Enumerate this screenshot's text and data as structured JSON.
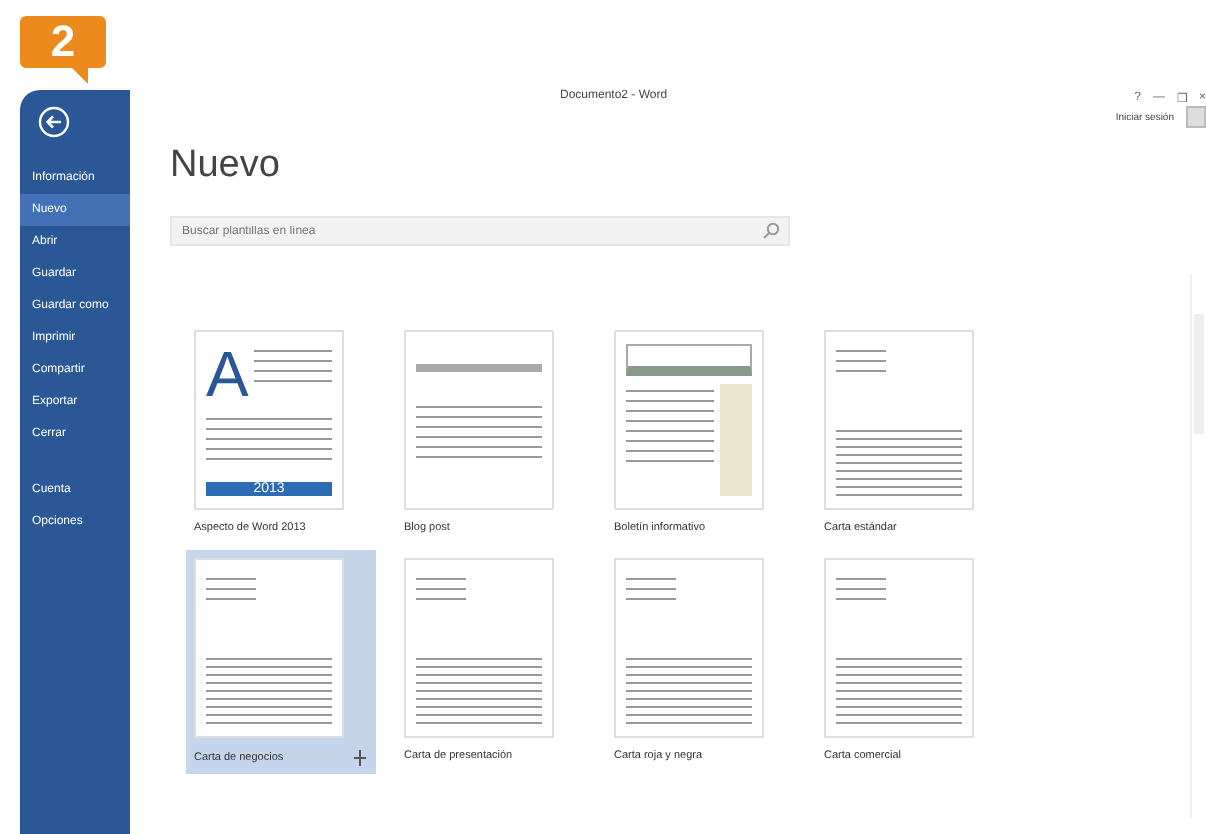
{
  "step_badge": "2",
  "window": {
    "title": "Documento2 - Word",
    "controls": [
      "?",
      "—",
      "❐",
      "×"
    ],
    "account": "Iniciar sesión"
  },
  "sidebar": {
    "items": [
      {
        "label": "Información",
        "selected": false
      },
      {
        "label": "Nuevo",
        "selected": true
      },
      {
        "label": "Abrir",
        "selected": false
      },
      {
        "label": "Guardar",
        "selected": false
      },
      {
        "label": "Guardar como",
        "selected": false
      },
      {
        "label": "Imprimir",
        "selected": false
      },
      {
        "label": "Compartir",
        "selected": false
      },
      {
        "label": "Exportar",
        "selected": false
      },
      {
        "label": "Cerrar",
        "selected": false
      },
      {
        "label": "Cuenta",
        "selected": false
      },
      {
        "label": "Opciones",
        "selected": false
      }
    ]
  },
  "page": {
    "heading": "Nuevo",
    "search": {
      "placeholder": "Buscar plantillas en línea"
    },
    "templates": [
      {
        "name": "Aspecto de Word 2013",
        "kind": "welcome",
        "glyph": "A",
        "badge": "2013",
        "selected": false
      },
      {
        "name": "Blog post",
        "kind": "blog",
        "selected": false
      },
      {
        "name": "Boletín informativo",
        "kind": "newsletter",
        "selected": false
      },
      {
        "name": "Carta estándar",
        "kind": "letter",
        "selected": false
      },
      {
        "name": "Carta de negocios",
        "kind": "letter",
        "selected": true
      },
      {
        "name": "Carta de presentación",
        "kind": "letter",
        "selected": false
      },
      {
        "name": "Carta roja y negra",
        "kind": "letter",
        "selected": false
      },
      {
        "name": "Carta comercial",
        "kind": "letter",
        "selected": false
      }
    ]
  }
}
